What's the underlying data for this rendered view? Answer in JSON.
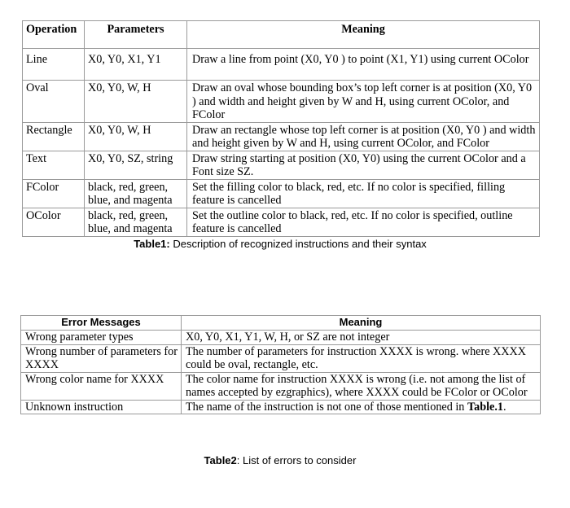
{
  "table1": {
    "headers": [
      "Operation",
      "Parameters",
      "Meaning"
    ],
    "rows": [
      {
        "operation": "Line",
        "parameters": "X0, Y0, X1, Y1",
        "meaning": "Draw a line from point (X0, Y0 ) to  point (X1, Y1) using current OColor"
      },
      {
        "operation": "Oval",
        "parameters": "X0, Y0, W, H",
        "meaning": "Draw an oval whose  bounding box’s top left corner is at position (X0, Y0 ) and width and height given by W and H, using current OColor, and FColor"
      },
      {
        "operation": "Rectangle",
        "parameters": "X0, Y0, W, H",
        "meaning": "Draw an rectangle whose  top left corner is at position (X0, Y0 ) and width and height given by W and H,  using current OColor, and FColor"
      },
      {
        "operation": "Text",
        "parameters": "X0, Y0, SZ, string",
        "meaning": "Draw string starting at position (X0, Y0) using the current OColor and a Font size SZ."
      },
      {
        "operation": "FColor",
        "parameters": "black, red, green, blue, and magenta",
        "meaning": "Set the filling color to black, red, etc. If no color is specified, filling feature is cancelled"
      },
      {
        "operation": "OColor",
        "parameters": "black, red, green, blue, and magenta",
        "meaning": "Set the outline color to black, red, etc.  If no color is specified, outline feature is cancelled"
      }
    ],
    "caption_label": "Table1:",
    "caption_text": " Description of recognized instructions and their syntax"
  },
  "table2": {
    "headers": [
      "Error Messages",
      "Meaning"
    ],
    "rows": [
      {
        "message": "Wrong parameter types",
        "meaning": "X0, Y0, X1, Y1, W, H, or SZ are not integer"
      },
      {
        "message": "Wrong number of parameters for XXXX",
        "meaning": "The number of parameters for instruction XXXX is wrong. where XXXX could be oval, rectangle, etc."
      },
      {
        "message": "Wrong color name for XXXX",
        "meaning": "The color name for instruction XXXX is wrong (i.e. not among the list of names accepted by ezgraphics), where XXXX could be FColor or OColor"
      },
      {
        "message": "Unknown instruction",
        "meaning_prefix": "The name of the instruction is not one of those mentioned in ",
        "meaning_bold": "Table.1",
        "meaning_suffix": "."
      }
    ],
    "caption_label": "Table2",
    "caption_text": ": List of errors to consider"
  }
}
